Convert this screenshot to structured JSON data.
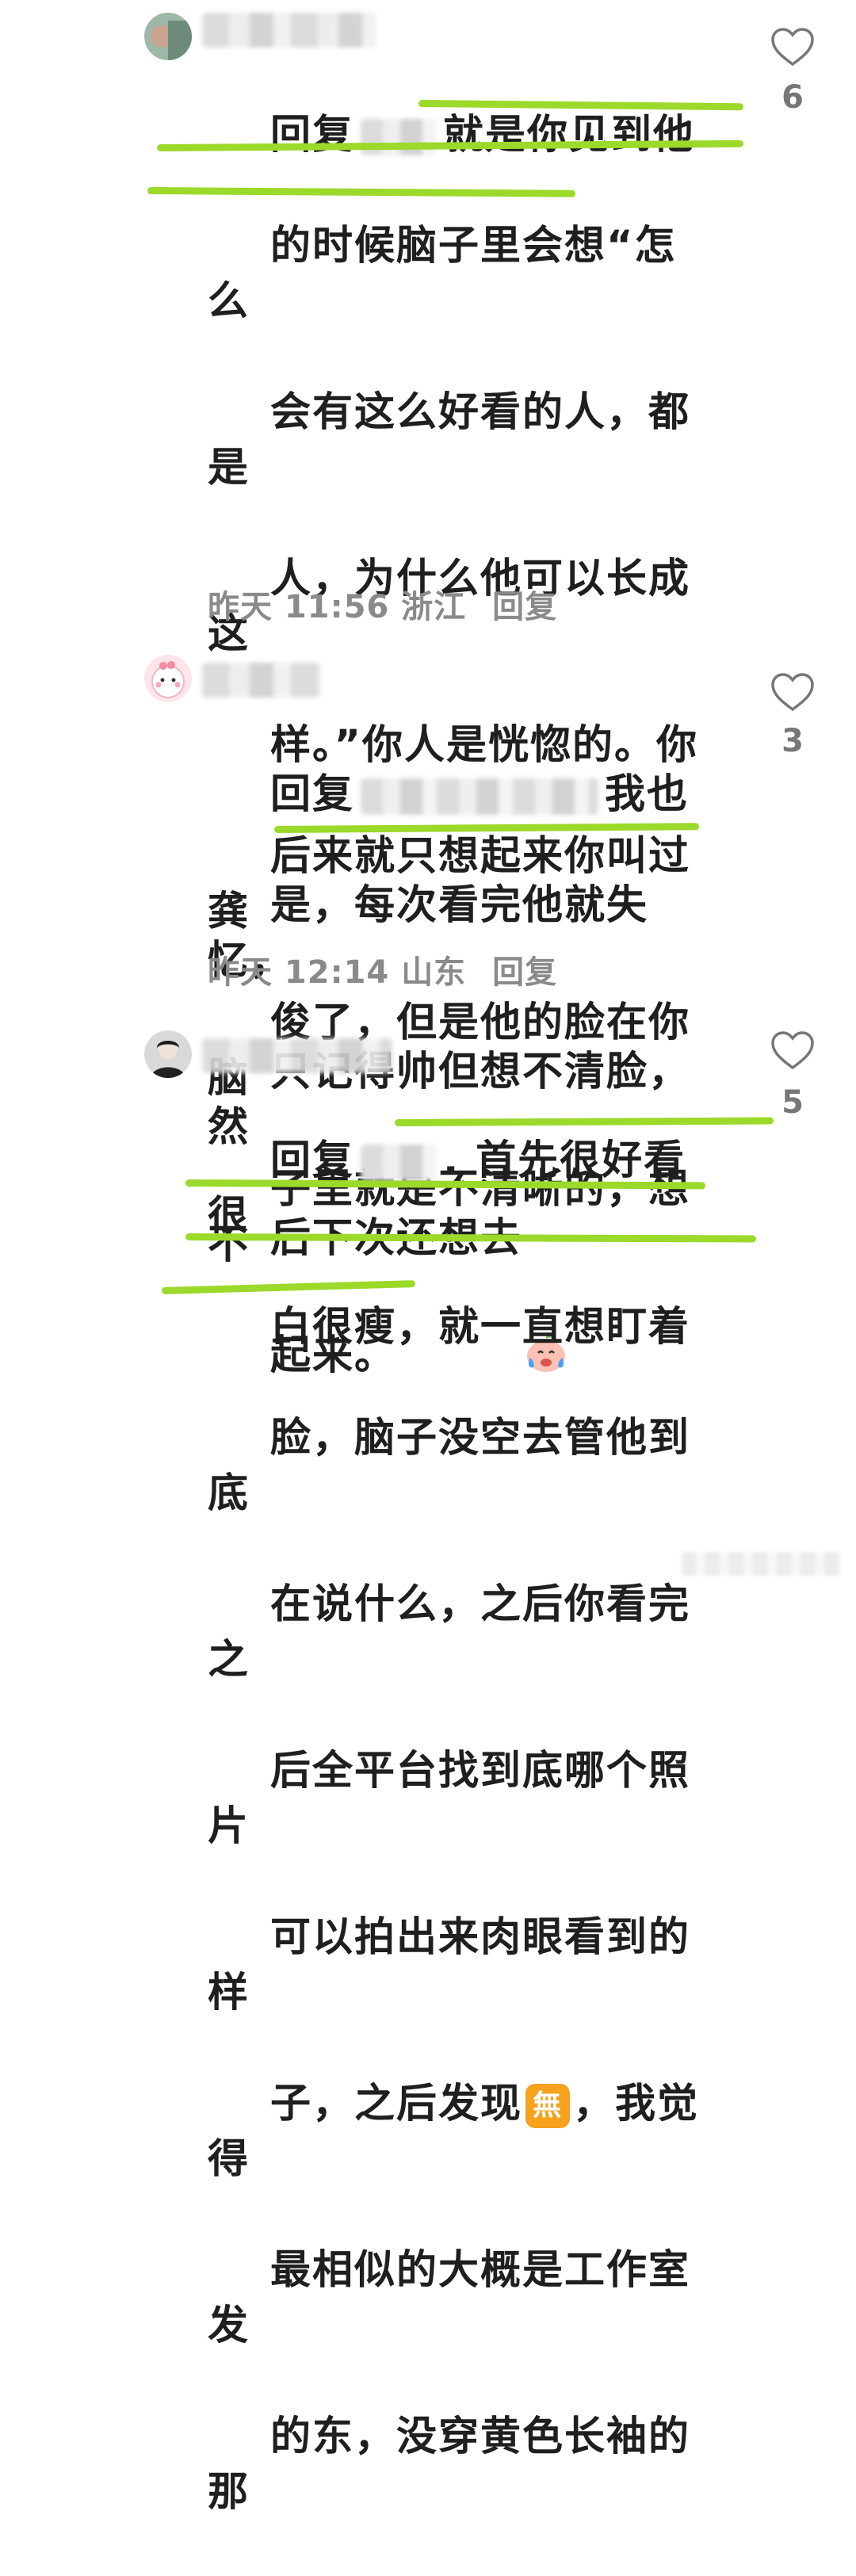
{
  "comments": [
    {
      "reply_prefix": "回复",
      "body": "就是你见到他的时候脑子里会想“怎么会有这么好看的人，都是人，为什么他可以长成这样。”你人是恍惚的。你后来就只想起来你叫过龚俊了，但是他的脸在你脑子里就是不清晰的，想不起来。",
      "lines": [
        "就是你见到他",
        "的时候脑子里会想“怎么",
        "会有这么好看的人，都是",
        "人，为什么他可以长成这",
        "样。”你人是恍惚的。你",
        "后来就只想起来你叫过龚",
        "俊了，但是他的脸在你脑",
        "子里就是不清晰的，想不",
        "起来。"
      ],
      "time": "昨天 11:56",
      "location": "浙江",
      "reply_label": "回复",
      "likes": "6"
    },
    {
      "reply_prefix": "回复",
      "lines": [
        "我也",
        "是，每次看完他就失忆，",
        "只记得帅但想不清脸，然",
        "后下次还想去"
      ],
      "time": "昨天 12:14",
      "location": "山东",
      "reply_label": "回复",
      "likes": "3"
    },
    {
      "reply_prefix": "回复",
      "lines": [
        ". 首先很好看很",
        "白很瘦，就一直想盯着",
        "脸，脑子没空去管他到底",
        "在说什么，之后你看完之",
        "后全平台找到底哪个照片",
        "可以拍出来肉眼看到的样",
        "子，之后发现",
        "，我觉得",
        "最相似的大概是工作室发",
        "的东，没穿黄色长袖的那"
      ],
      "badge": "無",
      "likes": "5"
    }
  ],
  "colors": {
    "highlight": "#9bd92b",
    "meta": "#8a8a8a",
    "text": "#1f1f1f"
  }
}
